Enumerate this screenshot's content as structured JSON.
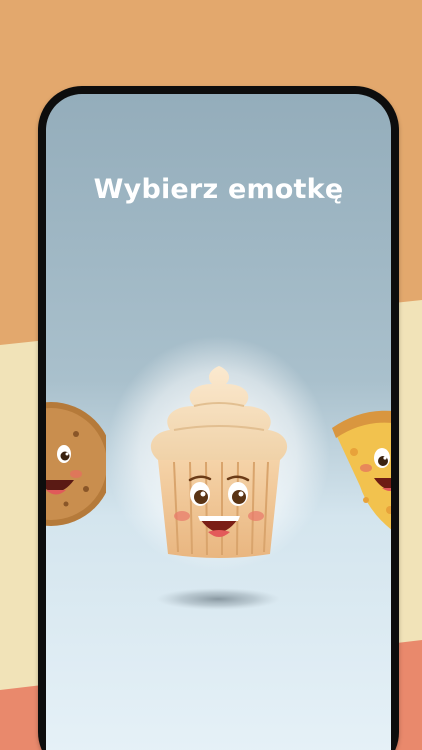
{
  "screen": {
    "title": "Wybierz emotkę"
  },
  "carousel": {
    "items": [
      {
        "icon": "cookie-face-icon"
      },
      {
        "icon": "cupcake-face-icon",
        "selected": true
      },
      {
        "icon": "pizza-face-icon"
      }
    ]
  },
  "colors": {
    "background_top": "#E3A86D",
    "background_middle": "#F1E3B8",
    "background_bottom": "#E9896C",
    "screen_top": "#94ADBB",
    "screen_bottom": "#E7F2F8",
    "phone_frame": "#0D0D0D",
    "title_text": "#FFFFFF"
  }
}
